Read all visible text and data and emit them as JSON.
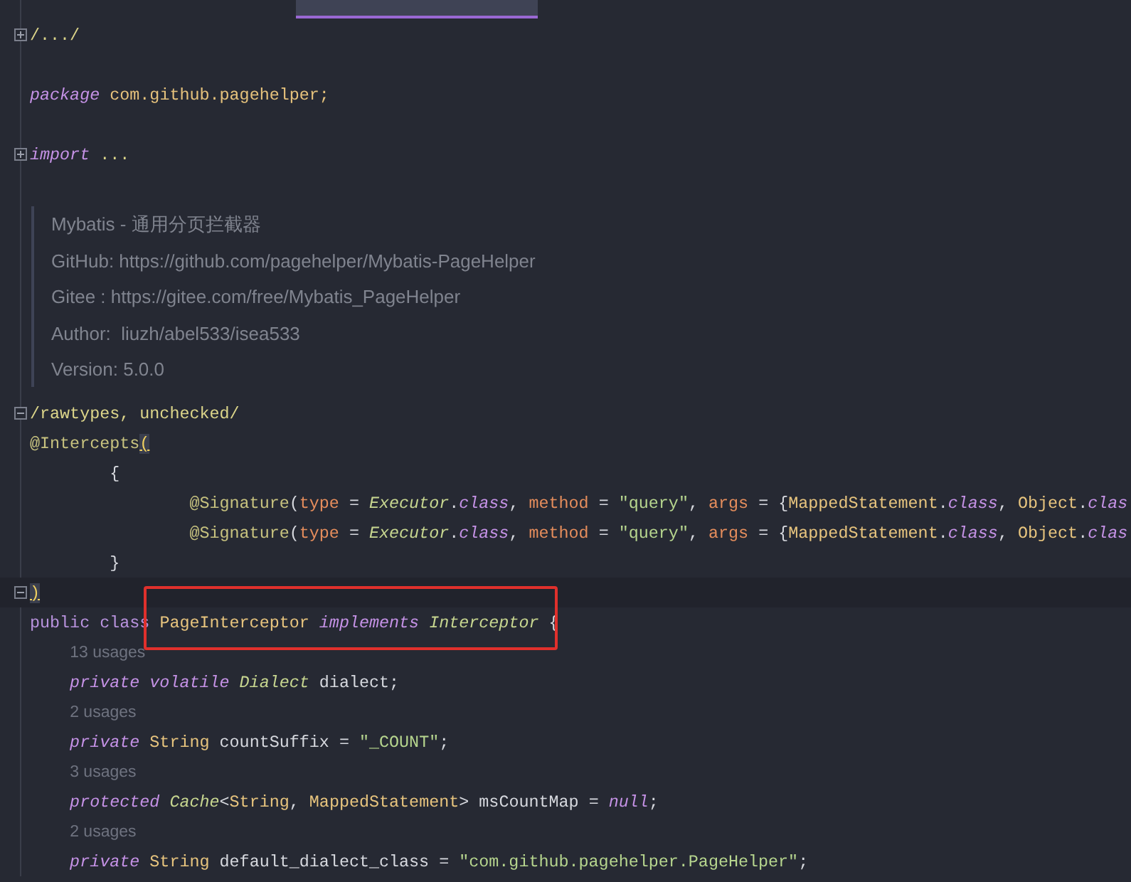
{
  "lines": [
    {
      "kind": "code",
      "folded": true,
      "current": false,
      "tokens": [
        {
          "text": "/.../",
          "kind": "folded"
        }
      ]
    },
    {
      "kind": "blank"
    },
    {
      "kind": "code",
      "current": false,
      "tokens": [
        {
          "text": "package",
          "kind": "keyword"
        },
        {
          "text": " com.github.pagehelper;",
          "kind": "package"
        }
      ]
    },
    {
      "kind": "blank"
    },
    {
      "kind": "code",
      "folded": true,
      "current": false,
      "tokens": [
        {
          "text": "import",
          "kind": "keyword"
        },
        {
          "text": " ...",
          "kind": "folded"
        }
      ]
    },
    {
      "kind": "blank"
    },
    {
      "kind": "doc",
      "lines": [
        "Mybatis - 通用分页拦截器",
        "GitHub: https://github.com/pagehelper/Mybatis-PageHelper",
        "Gitee : https://gitee.com/free/Mybatis_PageHelper",
        "Author:  liuzh/abel533/isea533",
        "Version: 5.0.0"
      ]
    },
    {
      "kind": "code",
      "folded": false,
      "current": false,
      "tokens": [
        {
          "text": "/rawtypes, unchecked/",
          "kind": "folded"
        }
      ]
    },
    {
      "kind": "code",
      "current": false,
      "tokens": [
        {
          "text": "@Intercepts",
          "kind": "annotation"
        },
        {
          "text": "(",
          "kind": "bracket-match"
        }
      ]
    },
    {
      "kind": "code",
      "current": false,
      "tokens": [
        {
          "text": "        {",
          "kind": "plain"
        }
      ]
    },
    {
      "kind": "code",
      "current": false,
      "tokens": [
        {
          "text": "                @Signature",
          "kind": "annotation"
        },
        {
          "text": "(",
          "kind": "plain"
        },
        {
          "text": "type",
          "kind": "param"
        },
        {
          "text": " = ",
          "kind": "plain"
        },
        {
          "text": "Executor",
          "kind": "interface"
        },
        {
          "text": ".",
          "kind": "plain"
        },
        {
          "text": "class",
          "kind": "keyword"
        },
        {
          "text": ", ",
          "kind": "plain"
        },
        {
          "text": "method",
          "kind": "param"
        },
        {
          "text": " = ",
          "kind": "plain"
        },
        {
          "text": "\"query\"",
          "kind": "string"
        },
        {
          "text": ", ",
          "kind": "plain"
        },
        {
          "text": "args",
          "kind": "param"
        },
        {
          "text": " = {",
          "kind": "plain"
        },
        {
          "text": "MappedStatement",
          "kind": "class-name"
        },
        {
          "text": ".",
          "kind": "plain"
        },
        {
          "text": "class",
          "kind": "keyword"
        },
        {
          "text": ", ",
          "kind": "plain"
        },
        {
          "text": "Object",
          "kind": "class-name"
        },
        {
          "text": ".",
          "kind": "plain"
        },
        {
          "text": "clas",
          "kind": "keyword"
        }
      ]
    },
    {
      "kind": "code",
      "current": false,
      "tokens": [
        {
          "text": "                @Signature",
          "kind": "annotation"
        },
        {
          "text": "(",
          "kind": "plain"
        },
        {
          "text": "type",
          "kind": "param"
        },
        {
          "text": " = ",
          "kind": "plain"
        },
        {
          "text": "Executor",
          "kind": "interface"
        },
        {
          "text": ".",
          "kind": "plain"
        },
        {
          "text": "class",
          "kind": "keyword"
        },
        {
          "text": ", ",
          "kind": "plain"
        },
        {
          "text": "method",
          "kind": "param"
        },
        {
          "text": " = ",
          "kind": "plain"
        },
        {
          "text": "\"query\"",
          "kind": "string"
        },
        {
          "text": ", ",
          "kind": "plain"
        },
        {
          "text": "args",
          "kind": "param"
        },
        {
          "text": " = {",
          "kind": "plain"
        },
        {
          "text": "MappedStatement",
          "kind": "class-name"
        },
        {
          "text": ".",
          "kind": "plain"
        },
        {
          "text": "class",
          "kind": "keyword"
        },
        {
          "text": ", ",
          "kind": "plain"
        },
        {
          "text": "Object",
          "kind": "class-name"
        },
        {
          "text": ".",
          "kind": "plain"
        },
        {
          "text": "clas",
          "kind": "keyword"
        }
      ]
    },
    {
      "kind": "code",
      "current": false,
      "tokens": [
        {
          "text": "        }",
          "kind": "plain"
        }
      ]
    },
    {
      "kind": "code",
      "folded": false,
      "current": true,
      "tokens": [
        {
          "text": ")",
          "kind": "bracket-match"
        }
      ]
    },
    {
      "kind": "code",
      "current": false,
      "tokens": [
        {
          "text": "public class ",
          "kind": "keyword-plain"
        },
        {
          "kind": "box",
          "tokens": [
            {
              "text": "PageInterceptor",
              "kind": "class-name"
            },
            {
              "text": " implements ",
              "kind": "keyword"
            },
            {
              "text": "Interceptor",
              "kind": "interface"
            }
          ]
        },
        {
          "text": " {",
          "kind": "plain"
        }
      ]
    },
    {
      "kind": "hint",
      "text": "13 usages"
    },
    {
      "kind": "code",
      "current": false,
      "tokens": [
        {
          "text": "    private volatile ",
          "kind": "keyword"
        },
        {
          "text": "Dialect",
          "kind": "interface"
        },
        {
          "text": " dialect;",
          "kind": "plain"
        }
      ]
    },
    {
      "kind": "hint",
      "text": "2 usages"
    },
    {
      "kind": "code",
      "current": false,
      "tokens": [
        {
          "text": "    private ",
          "kind": "keyword"
        },
        {
          "text": "String",
          "kind": "class-name"
        },
        {
          "text": " countSuffix = ",
          "kind": "plain"
        },
        {
          "text": "\"_COUNT\"",
          "kind": "string"
        },
        {
          "text": ";",
          "kind": "plain"
        }
      ]
    },
    {
      "kind": "hint",
      "text": "3 usages"
    },
    {
      "kind": "code",
      "current": false,
      "tokens": [
        {
          "text": "    protected ",
          "kind": "keyword"
        },
        {
          "text": "Cache",
          "kind": "interface"
        },
        {
          "text": "<",
          "kind": "plain"
        },
        {
          "text": "String",
          "kind": "class-name"
        },
        {
          "text": ", ",
          "kind": "plain"
        },
        {
          "text": "MappedStatement",
          "kind": "class-name"
        },
        {
          "text": "> msCountMap = ",
          "kind": "plain"
        },
        {
          "text": "null",
          "kind": "keyword"
        },
        {
          "text": ";",
          "kind": "plain"
        }
      ]
    },
    {
      "kind": "hint",
      "text": "2 usages"
    },
    {
      "kind": "code",
      "current": false,
      "tokens": [
        {
          "text": "    private ",
          "kind": "keyword"
        },
        {
          "text": "String",
          "kind": "class-name"
        },
        {
          "text": " default_dialect_class = ",
          "kind": "plain"
        },
        {
          "text": "\"com.github.pagehelper.PageHelper\"",
          "kind": "string"
        },
        {
          "text": ";",
          "kind": "plain"
        }
      ]
    }
  ]
}
